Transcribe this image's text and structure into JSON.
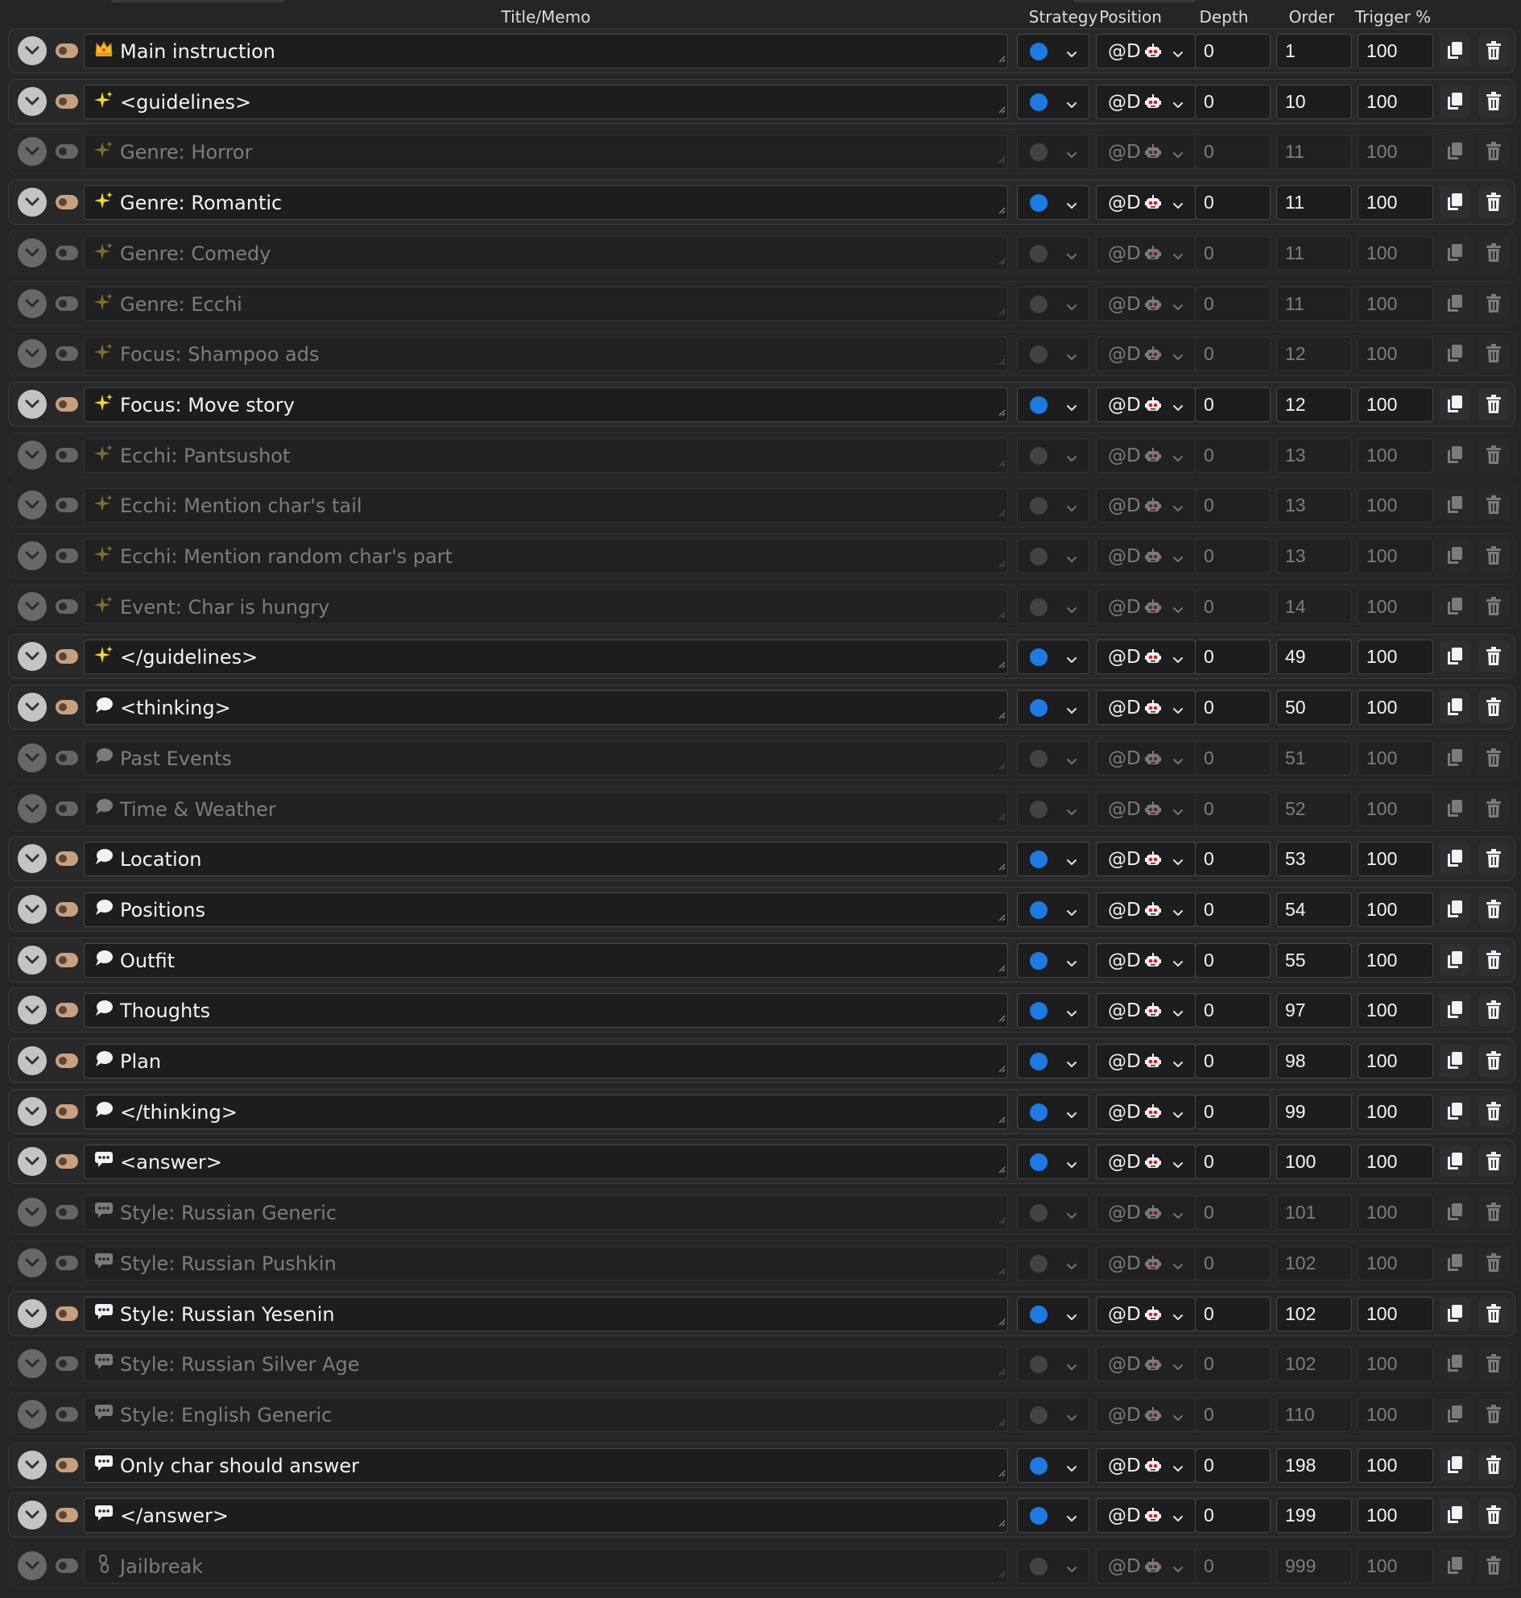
{
  "header": {
    "title": "Title/Memo",
    "strategy": "Strategy",
    "position": "Position",
    "depth": "Depth",
    "order": "Order",
    "trigger": "Trigger %"
  },
  "colors": {
    "accent_blue": "#1e7ae0",
    "toggle_on": "#c8a07f",
    "sparkle_yellow": "#f5d33a"
  },
  "rows": [
    {
      "icon": "crown-icon",
      "title": "Main instruction",
      "enabled": true,
      "position": "@D",
      "depth": "0",
      "order": "1",
      "trigger": "100"
    },
    {
      "icon": "sparkle-icon",
      "title": "<guidelines>",
      "enabled": true,
      "position": "@D",
      "depth": "0",
      "order": "10",
      "trigger": "100"
    },
    {
      "icon": "sparkle-icon",
      "title": "Genre: Horror",
      "enabled": false,
      "position": "@D",
      "depth": "0",
      "order": "11",
      "trigger": "100"
    },
    {
      "icon": "sparkle-icon",
      "title": "Genre: Romantic",
      "enabled": true,
      "position": "@D",
      "depth": "0",
      "order": "11",
      "trigger": "100"
    },
    {
      "icon": "sparkle-icon",
      "title": "Genre: Comedy",
      "enabled": false,
      "position": "@D",
      "depth": "0",
      "order": "11",
      "trigger": "100"
    },
    {
      "icon": "sparkle-icon",
      "title": "Genre: Ecchi",
      "enabled": false,
      "position": "@D",
      "depth": "0",
      "order": "11",
      "trigger": "100"
    },
    {
      "icon": "sparkle-icon",
      "title": "Focus: Shampoo ads",
      "enabled": false,
      "position": "@D",
      "depth": "0",
      "order": "12",
      "trigger": "100"
    },
    {
      "icon": "sparkle-icon",
      "title": "Focus: Move story",
      "enabled": true,
      "position": "@D",
      "depth": "0",
      "order": "12",
      "trigger": "100"
    },
    {
      "icon": "sparkle-icon",
      "title": "Ecchi: Pantsushot",
      "enabled": false,
      "position": "@D",
      "depth": "0",
      "order": "13",
      "trigger": "100"
    },
    {
      "icon": "sparkle-icon",
      "title": "Ecchi: Mention char's tail",
      "enabled": false,
      "position": "@D",
      "depth": "0",
      "order": "13",
      "trigger": "100"
    },
    {
      "icon": "sparkle-icon",
      "title": "Ecchi: Mention random char's part",
      "enabled": false,
      "position": "@D",
      "depth": "0",
      "order": "13",
      "trigger": "100"
    },
    {
      "icon": "sparkle-icon",
      "title": "Event: Char is hungry",
      "enabled": false,
      "position": "@D",
      "depth": "0",
      "order": "14",
      "trigger": "100"
    },
    {
      "icon": "sparkle-icon",
      "title": "</guidelines>",
      "enabled": true,
      "position": "@D",
      "depth": "0",
      "order": "49",
      "trigger": "100"
    },
    {
      "icon": "speech-bubble-icon",
      "title": "<thinking>",
      "enabled": true,
      "position": "@D",
      "depth": "0",
      "order": "50",
      "trigger": "100"
    },
    {
      "icon": "speech-bubble-icon",
      "title": "Past Events",
      "enabled": false,
      "position": "@D",
      "depth": "0",
      "order": "51",
      "trigger": "100"
    },
    {
      "icon": "speech-bubble-icon",
      "title": "Time & Weather",
      "enabled": false,
      "position": "@D",
      "depth": "0",
      "order": "52",
      "trigger": "100"
    },
    {
      "icon": "speech-bubble-icon",
      "title": "Location",
      "enabled": true,
      "position": "@D",
      "depth": "0",
      "order": "53",
      "trigger": "100"
    },
    {
      "icon": "speech-bubble-icon",
      "title": "Positions",
      "enabled": true,
      "position": "@D",
      "depth": "0",
      "order": "54",
      "trigger": "100"
    },
    {
      "icon": "speech-bubble-icon",
      "title": "Outfit",
      "enabled": true,
      "position": "@D",
      "depth": "0",
      "order": "55",
      "trigger": "100"
    },
    {
      "icon": "speech-bubble-icon",
      "title": "Thoughts",
      "enabled": true,
      "position": "@D",
      "depth": "0",
      "order": "97",
      "trigger": "100"
    },
    {
      "icon": "speech-bubble-icon",
      "title": "Plan",
      "enabled": true,
      "position": "@D",
      "depth": "0",
      "order": "98",
      "trigger": "100"
    },
    {
      "icon": "speech-bubble-icon",
      "title": "</thinking>",
      "enabled": true,
      "position": "@D",
      "depth": "0",
      "order": "99",
      "trigger": "100"
    },
    {
      "icon": "chat-icon",
      "title": "<answer>",
      "enabled": true,
      "position": "@D",
      "depth": "0",
      "order": "100",
      "trigger": "100"
    },
    {
      "icon": "chat-icon",
      "title": "Style: Russian Generic",
      "enabled": false,
      "position": "@D",
      "depth": "0",
      "order": "101",
      "trigger": "100"
    },
    {
      "icon": "chat-icon",
      "title": "Style: Russian Pushkin",
      "enabled": false,
      "position": "@D",
      "depth": "0",
      "order": "102",
      "trigger": "100"
    },
    {
      "icon": "chat-icon",
      "title": "Style: Russian Yesenin",
      "enabled": true,
      "position": "@D",
      "depth": "0",
      "order": "102",
      "trigger": "100"
    },
    {
      "icon": "chat-icon",
      "title": "Style: Russian Silver Age",
      "enabled": false,
      "position": "@D",
      "depth": "0",
      "order": "102",
      "trigger": "100"
    },
    {
      "icon": "chat-icon",
      "title": "Style: English Generic",
      "enabled": false,
      "position": "@D",
      "depth": "0",
      "order": "110",
      "trigger": "100"
    },
    {
      "icon": "chat-icon",
      "title": "Only char should answer",
      "enabled": true,
      "position": "@D",
      "depth": "0",
      "order": "198",
      "trigger": "100"
    },
    {
      "icon": "chat-icon",
      "title": "</answer>",
      "enabled": true,
      "position": "@D",
      "depth": "0",
      "order": "199",
      "trigger": "100"
    },
    {
      "icon": "chain-icon",
      "title": "Jailbreak",
      "enabled": false,
      "position": "@D",
      "depth": "0",
      "order": "999",
      "trigger": "100"
    }
  ]
}
